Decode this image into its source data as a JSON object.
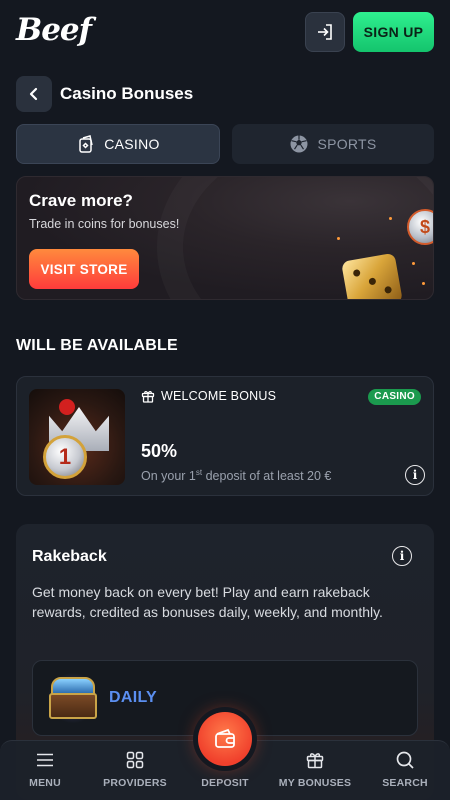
{
  "header": {
    "logo": "Beef",
    "login_icon": "login-icon",
    "signup_label": "SIGN UP"
  },
  "page": {
    "title": "Casino Bonuses"
  },
  "tabs": [
    {
      "label": "CASINO",
      "icon": "cards-icon",
      "active": true
    },
    {
      "label": "SPORTS",
      "icon": "soccer-ball-icon",
      "active": false
    }
  ],
  "promo": {
    "title": "Crave more?",
    "subtitle": "Trade in coins for bonuses!",
    "button_label": "VISIT STORE",
    "coin_symbol": "$"
  },
  "section": {
    "title": "WILL BE AVAILABLE"
  },
  "bonus": {
    "type_label": "WELCOME BONUS",
    "badge": "CASINO",
    "amount": "50%",
    "desc_prefix": "On your 1",
    "desc_sup": "st",
    "desc_suffix": " deposit of at least 20 €",
    "image_number": "1"
  },
  "rakeback": {
    "title": "Rakeback",
    "text": "Get money back on every bet! Play and earn rakeback rewards, credited as bonuses daily, weekly, and monthly.",
    "daily_label": "DAILY"
  },
  "nav": {
    "items": [
      {
        "label": "MENU",
        "icon": "menu-icon"
      },
      {
        "label": "PROVIDERS",
        "icon": "grid-icon"
      },
      {
        "label": "DEPOSIT",
        "icon": "wallet-icon"
      },
      {
        "label": "MY BONUSES",
        "icon": "gift-icon"
      },
      {
        "label": "SEARCH",
        "icon": "search-icon"
      }
    ]
  },
  "colors": {
    "background": "#141820",
    "signup": "#1fd57a",
    "visit_store": "#ff5a3a",
    "badge": "#1b9a4e",
    "daily": "#5b8ff0",
    "deposit": "#f0402c"
  }
}
